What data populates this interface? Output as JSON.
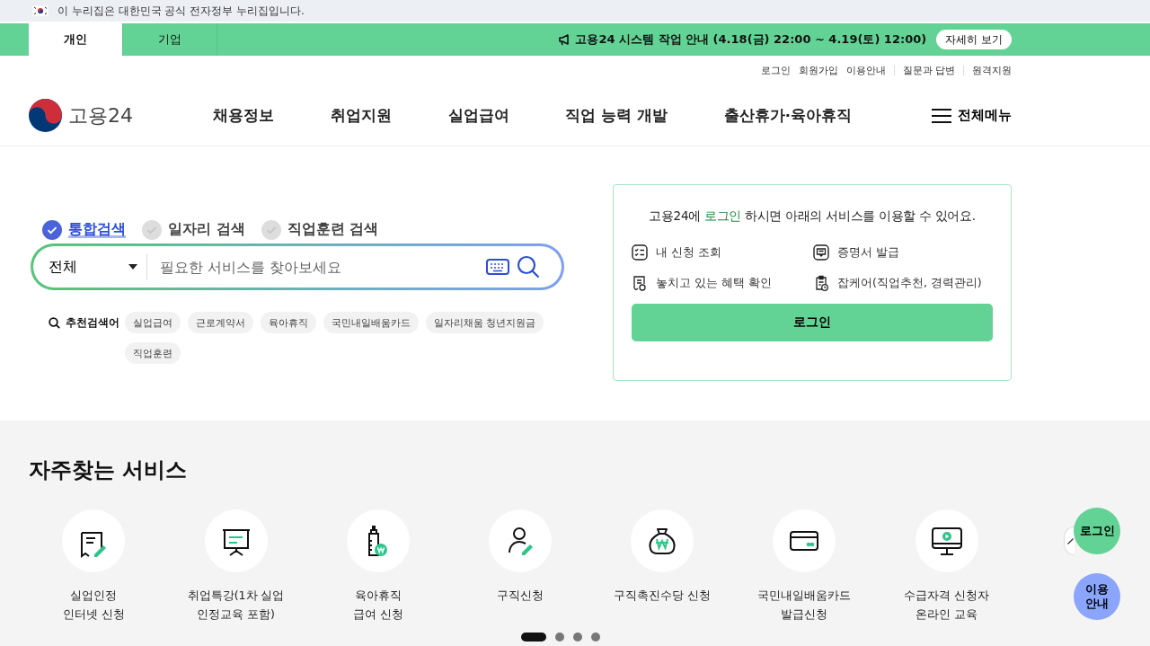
{
  "gov_banner": {
    "text": "이 누리집은 대한민국 공식 전자정부 누리집입니다."
  },
  "audience_tabs": [
    {
      "label": "개인",
      "selected": true
    },
    {
      "label": "기업",
      "selected": false
    }
  ],
  "notice": {
    "text": "고용24 시스템 작업 안내 (4.18(금) 22:00 ~ 4.19(토) 12:00)",
    "button": "자세히 보기"
  },
  "util_links": [
    "로그인",
    "회원가입",
    "이용안내",
    "질문과 답변",
    "원격지원"
  ],
  "header": {
    "logo": "고용24",
    "nav": [
      "채용정보",
      "취업지원",
      "실업급여",
      "직업 능력 개발",
      "출산휴가·육아휴직"
    ],
    "menu": "전체메뉴"
  },
  "search_types": [
    {
      "label": "통합검색",
      "selected": true
    },
    {
      "label": "일자리 검색",
      "selected": false
    },
    {
      "label": "직업훈련 검색",
      "selected": false
    }
  ],
  "search": {
    "category": "전체",
    "placeholder": "필요한 서비스를 찾아보세요"
  },
  "recommended": {
    "label": "추천검색어",
    "chips": [
      "실업급여",
      "근로계약서",
      "육아휴직",
      "국민내일배움카드",
      "일자리채움 청년지원금",
      "직업훈련"
    ]
  },
  "login_card": {
    "before": "고용24에",
    "link": "로그인",
    "after": "하시면 아래의 서비스를 이용할 수 있어요.",
    "services": [
      "내 신청 조회",
      "증명서 발급",
      "놓치고 있는 혜택 확인",
      "잡케어(직업추천, 경력관리)"
    ],
    "button": "로그인"
  },
  "frequent": {
    "title": "자주찾는 서비스",
    "items": [
      {
        "lines": [
          "실업인정",
          "인터넷 신청"
        ]
      },
      {
        "lines": [
          "취업특강(1차 실업",
          "인정교육 포함)"
        ]
      },
      {
        "lines": [
          "육아휴직",
          "급여 신청"
        ]
      },
      {
        "lines": [
          "구직신청"
        ]
      },
      {
        "lines": [
          "구직촉진수당 신청"
        ]
      },
      {
        "lines": [
          "국민내일배움카드",
          "발급신청"
        ]
      },
      {
        "lines": [
          "수급자격 신청자",
          "온라인 교육"
        ]
      }
    ],
    "pager": [
      {
        "selected": true
      },
      {
        "selected": false
      },
      {
        "selected": false
      },
      {
        "selected": false
      }
    ]
  },
  "floating": [
    {
      "kind": "login",
      "lines": [
        "로그인"
      ]
    },
    {
      "kind": "guide",
      "lines": [
        "이용",
        "안내"
      ]
    }
  ]
}
